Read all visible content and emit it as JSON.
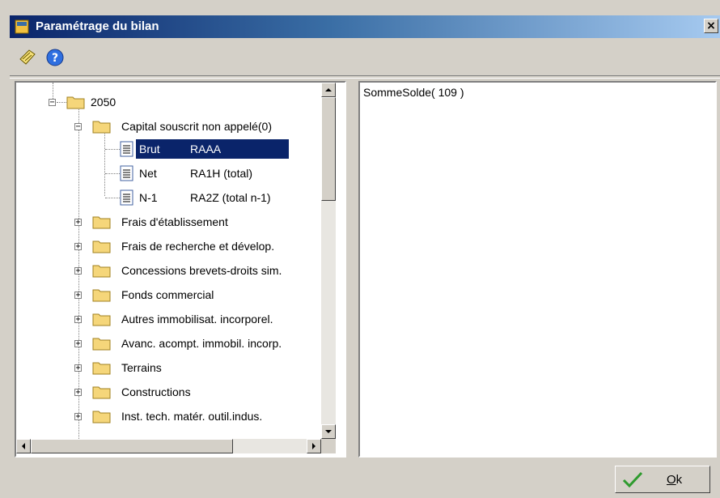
{
  "window": {
    "title": "Paramétrage du bilan",
    "close_label": "×"
  },
  "toolbar": {
    "icons": [
      "edit-icon",
      "help-icon"
    ]
  },
  "tree": {
    "root": "2050",
    "group": "Capital souscrit non appelé(0)",
    "leaves": [
      {
        "name": "Brut",
        "code": "RAAA",
        "selected": true
      },
      {
        "name": "Net",
        "code": "RA1H (total)",
        "selected": false
      },
      {
        "name": "N-1",
        "code": "RA2Z (total n-1)",
        "selected": false
      }
    ],
    "folders": [
      "Frais d'établissement",
      "Frais de recherche et dévelop.",
      "Concessions brevets-droits sim.",
      "Fonds commercial",
      "Autres immobilisat. incorporel.",
      "Avanc. acompt. immobil. incorp.",
      "Terrains",
      "Constructions",
      "Inst. tech. matér. outil.indus."
    ]
  },
  "formula": "SommeSolde( 109 )",
  "ok_button": {
    "underlined": "O",
    "rest": "k"
  },
  "colors": {
    "selection": "#0a246a",
    "folder": "#f5d67a",
    "title_start": "#0a246a",
    "check": "#2e9b2e"
  }
}
